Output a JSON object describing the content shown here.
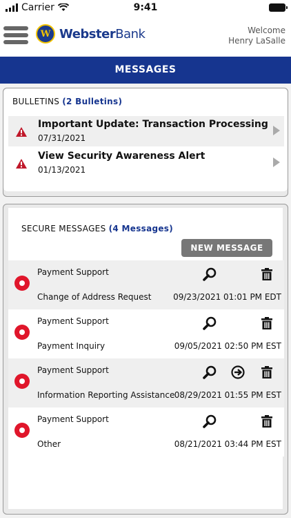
{
  "status": {
    "carrier": "Carrier",
    "time": "9:41"
  },
  "header": {
    "brand_bold": "Webster",
    "brand_thin": "Bank",
    "brand_mark": "W",
    "welcome_label": "Welcome",
    "user_name": "Henry LaSalle"
  },
  "title": "MESSAGES",
  "bulletins": {
    "label": "BULLETINS",
    "count_label": "(2 Bulletins)",
    "items": [
      {
        "title": "Important Update: Transaction Processing",
        "date": "07/31/2021"
      },
      {
        "title": "View Security Awareness Alert",
        "date": "01/13/2021"
      }
    ]
  },
  "secure": {
    "label": "SECURE MESSAGES",
    "count_label": "(4 Messages)",
    "new_button": "NEW MESSAGE",
    "messages": [
      {
        "from": "Payment Support",
        "subject": "Change of Address Request",
        "date": "09/23/2021 01:01 PM EDT"
      },
      {
        "from": "Payment Support",
        "subject": "Payment Inquiry",
        "date": "09/05/2021 02:50 PM EST"
      },
      {
        "from": "Payment Support",
        "subject": "Information Reporting Assistance",
        "date": "08/29/2021 01:55 PM EST"
      },
      {
        "from": "Payment Support",
        "subject": "Other",
        "date": "08/21/2021 03:44 PM EST"
      }
    ]
  },
  "colors": {
    "brand_blue": "#16358f",
    "alert_red": "#e0162b",
    "button_gray": "#777777"
  }
}
